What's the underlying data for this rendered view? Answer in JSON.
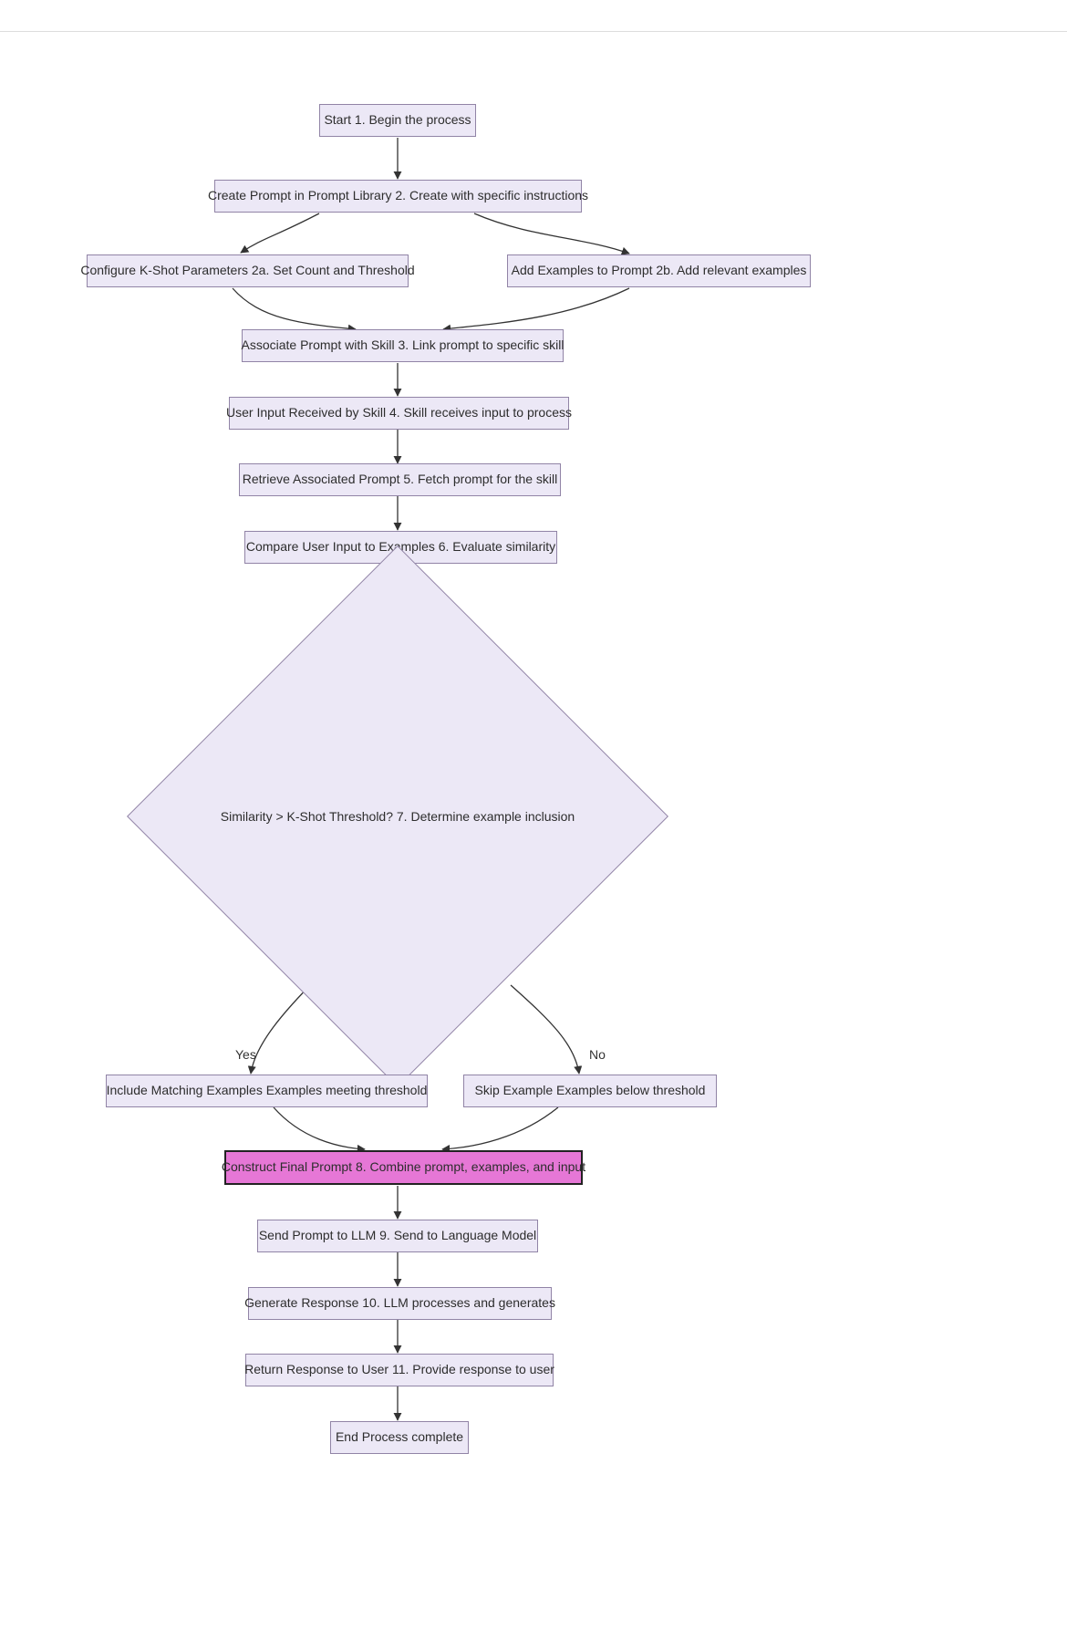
{
  "nodes": {
    "start": "Start 1. Begin the process",
    "create": "Create Prompt in Prompt Library 2. Create with specific instructions",
    "configure": "Configure K-Shot Parameters 2a. Set Count and Threshold",
    "addExamples": "Add Examples to Prompt 2b. Add relevant examples",
    "associate": "Associate Prompt with Skill 3. Link prompt to specific skill",
    "userInput": "User Input Received by Skill 4. Skill receives input to process",
    "retrieve": "Retrieve Associated Prompt 5. Fetch prompt for the skill",
    "compare": "Compare User Input to Examples 6. Evaluate similarity",
    "decision": "Similarity > K-Shot Threshold? 7. Determine example inclusion",
    "include": "Include Matching Examples Examples meeting threshold",
    "skip": "Skip Example Examples below threshold",
    "construct": "Construct Final Prompt 8. Combine prompt, examples, and input",
    "send": "Send Prompt to LLM 9. Send to Language Model",
    "generate": "Generate Response 10. LLM processes and generates",
    "return": "Return Response to User 11. Provide response to user",
    "end": "End Process complete"
  },
  "edgeLabels": {
    "yes": "Yes",
    "no": "No"
  },
  "colors": {
    "nodeFill": "#ece8f6",
    "nodeStroke": "#9184a6",
    "highlightFill": "#e677d6",
    "highlightStroke": "#222222",
    "arrow": "#333333"
  }
}
